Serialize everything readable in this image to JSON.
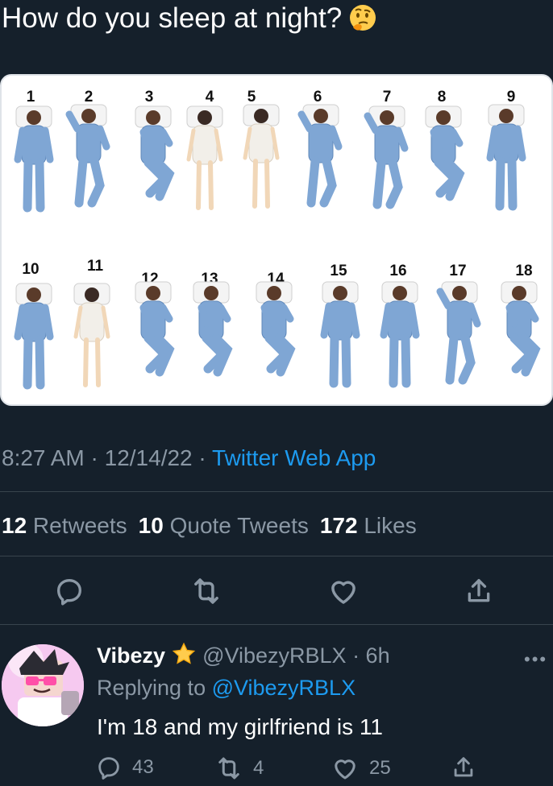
{
  "tweet": {
    "text": "How do you sleep at night?",
    "emoji": "thinking-face-emoji"
  },
  "media": {
    "positions": [
      "1",
      "2",
      "3",
      "4",
      "5",
      "6",
      "7",
      "8",
      "9",
      "10",
      "11",
      "12",
      "13",
      "14",
      "15",
      "16",
      "17",
      "18"
    ]
  },
  "meta": {
    "time": "8:27 AM",
    "sep1": " · ",
    "date": "12/14/22",
    "sep2": " · ",
    "source": "Twitter Web App"
  },
  "stats": {
    "retweets_count": "12",
    "retweets_label": " Retweets",
    "quotes_count": "10",
    "quotes_label": " Quote Tweets",
    "likes_count": "172",
    "likes_label": " Likes"
  },
  "actions": [
    "reply-icon",
    "retweet-icon",
    "like-icon",
    "share-icon"
  ],
  "reply": {
    "name": "Vibezy",
    "handle": "@VibezyRBLX",
    "time": " · 6h",
    "replying_prefix": "Replying to ",
    "replying_to": "@VibezyRBLX",
    "text": "I'm 18 and my girlfriend is 11",
    "more": "•••",
    "reply_count": "43",
    "retweet_count": "4",
    "like_count": "25"
  },
  "colors": {
    "background": "#15202b",
    "secondary_text": "#8b98a5",
    "link": "#1d9bf0",
    "divider": "#38444d"
  }
}
